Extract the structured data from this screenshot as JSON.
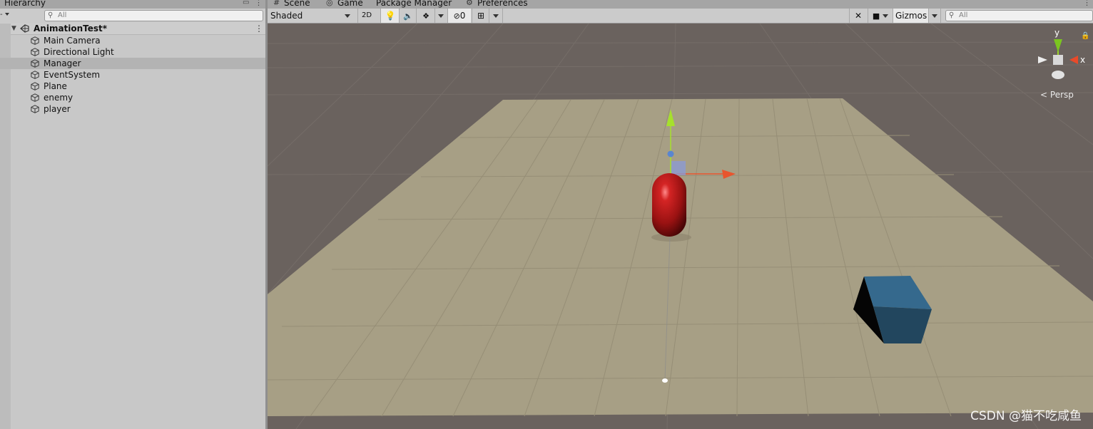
{
  "hierarchy": {
    "tab_label": "Hierarchy",
    "search_placeholder": "All",
    "scene_name": "AnimationTest*",
    "items": [
      {
        "label": "Main Camera"
      },
      {
        "label": "Directional Light"
      },
      {
        "label": "Manager",
        "selected": true
      },
      {
        "label": "EventSystem"
      },
      {
        "label": "Plane"
      },
      {
        "label": "enemy"
      },
      {
        "label": "player"
      }
    ]
  },
  "tabs": [
    {
      "label": "Scene",
      "icon": "hash-icon"
    },
    {
      "label": "Game",
      "icon": "gamepad-icon"
    },
    {
      "label": "Package Manager"
    },
    {
      "label": "Preferences",
      "icon": "gear-icon"
    }
  ],
  "scene_toolbar": {
    "draw_mode": "Shaded",
    "btn_2d": "2D",
    "hidden_count": "0",
    "gizmos_label": "Gizmos",
    "search_placeholder": "All"
  },
  "scene_view": {
    "projection_label": "Persp",
    "gizmo_axis_y": "y",
    "gizmo_axis_x": "x"
  },
  "watermark": "CSDN @猫不吃咸鱼",
  "colors": {
    "sky": "#6a625e",
    "ground": "#a79f85",
    "capsule": "#b01818",
    "cube": "#2d5a78"
  }
}
